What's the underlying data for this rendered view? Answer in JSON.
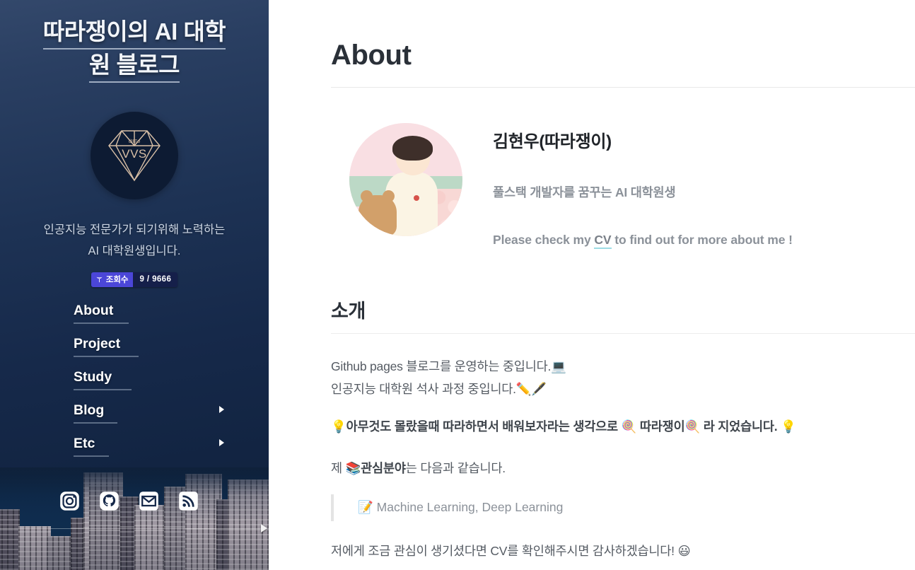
{
  "sidebar": {
    "site_title_line1": "따라쟁이의 AI 대학",
    "site_title_line2": "원 블로그",
    "logo_text": "VVS",
    "logo_subtext": "dIIEo",
    "tagline_line1": "인공지능 전문가가 되기위해 노력하는",
    "tagline_line2": "AI 대학원생입니다.",
    "badge": {
      "label": "조회수",
      "value": "9 / 9666",
      "label_bg": "#4b46d8",
      "value_bg": "#151f4a",
      "icon": "tesla-icon"
    },
    "nav": [
      {
        "label": "About",
        "has_submenu": false
      },
      {
        "label": "Project",
        "has_submenu": false
      },
      {
        "label": "Study",
        "has_submenu": false
      },
      {
        "label": "Blog",
        "has_submenu": true
      },
      {
        "label": "Etc",
        "has_submenu": true
      }
    ],
    "socials": [
      {
        "name": "instagram-icon"
      },
      {
        "name": "github-icon"
      },
      {
        "name": "email-icon"
      },
      {
        "name": "rss-icon"
      }
    ]
  },
  "main": {
    "page_title": "About",
    "profile": {
      "name": "김현우(따라쟁이)",
      "subtitle": "풀스택 개발자를 꿈꾸는 AI 대학원생",
      "cv_prefix": "Please check my ",
      "cv_link": "CV",
      "cv_suffix": " to find out for more about me !"
    },
    "section_title": "소개",
    "p1_line1": "Github pages 블로그를 운영하는 중입니다.",
    "p1_line1_emoji": "💻",
    "p1_line2": "인공지능 대학원 석사 과정 중입니다.",
    "p1_line2_emoji": "✏️🖋️",
    "p2_emoji_start": "💡",
    "p2_a": "아무것도 몰랐을때 따라하면서 배워보자라는 생각으로 ",
    "p2_emoji_1": "🍭",
    "p2_b": " 따라쟁이",
    "p2_emoji_2": "🍭",
    "p2_c": " 라 지었습니다. ",
    "p2_emoji_end": "💡",
    "p3_a": "제 ",
    "p3_emoji": "📚",
    "p3_b": "관심분야",
    "p3_c": "는 다음과 같습니다.",
    "quote_emoji": "📝",
    "quote_text": "Machine Learning, Deep Learning",
    "p4_text": "저에게 조금 관심이 생기셨다면 CV를 확인해주시면 감사하겠습니다! ",
    "p4_emoji": "😃"
  },
  "colors": {
    "sidebar_top": "#33486b",
    "sidebar_bottom": "#0f2039",
    "accent_underline": "#9ddce4",
    "badge_purple": "#4b46d8",
    "text_dark": "#2a3038",
    "text_muted": "#8b9199"
  }
}
